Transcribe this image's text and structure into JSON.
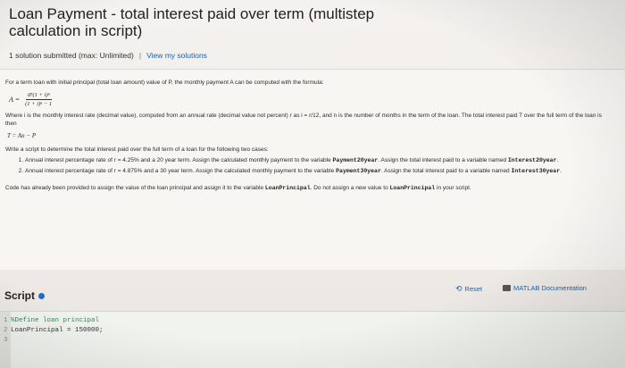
{
  "header": {
    "title": "Loan Payment - total interest paid over term (multistep calculation in script)",
    "submissions": "1 solution submitted (max: Unlimited)",
    "separator": "|",
    "view_solutions": "View my solutions"
  },
  "problem": {
    "intro": "For a term loan with initial principal (total loan amount) value of P, the monthly payment A can be computed with the formula:",
    "formula_lhs": "A =",
    "formula_num": "iP(1 + i)ⁿ",
    "formula_den": "(1 + i)ⁿ − 1",
    "where": "Where i is the monthly interest rate (decimal value), computed from an annual rate (decimal value not percent) r as i = r/12, and n is the number of months in the term of the loan. The total interest paid T over the full term of the loan is then",
    "total_formula": "T = An − P",
    "task": "Write a script to determine the total interest paid over the full term of a loan for the following two cases:",
    "case1_text": "Annual interest percentage rate of r = 4.25% and a 20 year term. Assign the calculated monthly payment to the variable ",
    "case1_var1": "Payment20year",
    "case1_text2": ". Assign the total interest paid to a variable named ",
    "case1_var2": "Interest20year",
    "case2_text": "Annual interest percentage rate of r = 4.875% and a 30 year term. Assign the calculated monthly payment to the variable ",
    "case2_var1": "Payment30year",
    "case2_text2": ". Assign the total interest paid to a variable named ",
    "case2_var2": "Interest30year",
    "code_note1": "Code has already been provided to assign the value of the loan principal and assign it to the variable ",
    "code_var": "LoanPrincipal",
    "code_note2": ". Do not assign a new value to ",
    "code_var2": "LoanPrincipal",
    "code_note3": " in your script."
  },
  "script": {
    "label": "Script",
    "reset": "Reset",
    "docs": "MATLAB Documentation"
  },
  "editor": {
    "lines": [
      {
        "n": "1",
        "text": "%Define loan principal"
      },
      {
        "n": "2",
        "text": "LoanPrincipal = 150000;"
      },
      {
        "n": "3",
        "text": ""
      }
    ]
  }
}
